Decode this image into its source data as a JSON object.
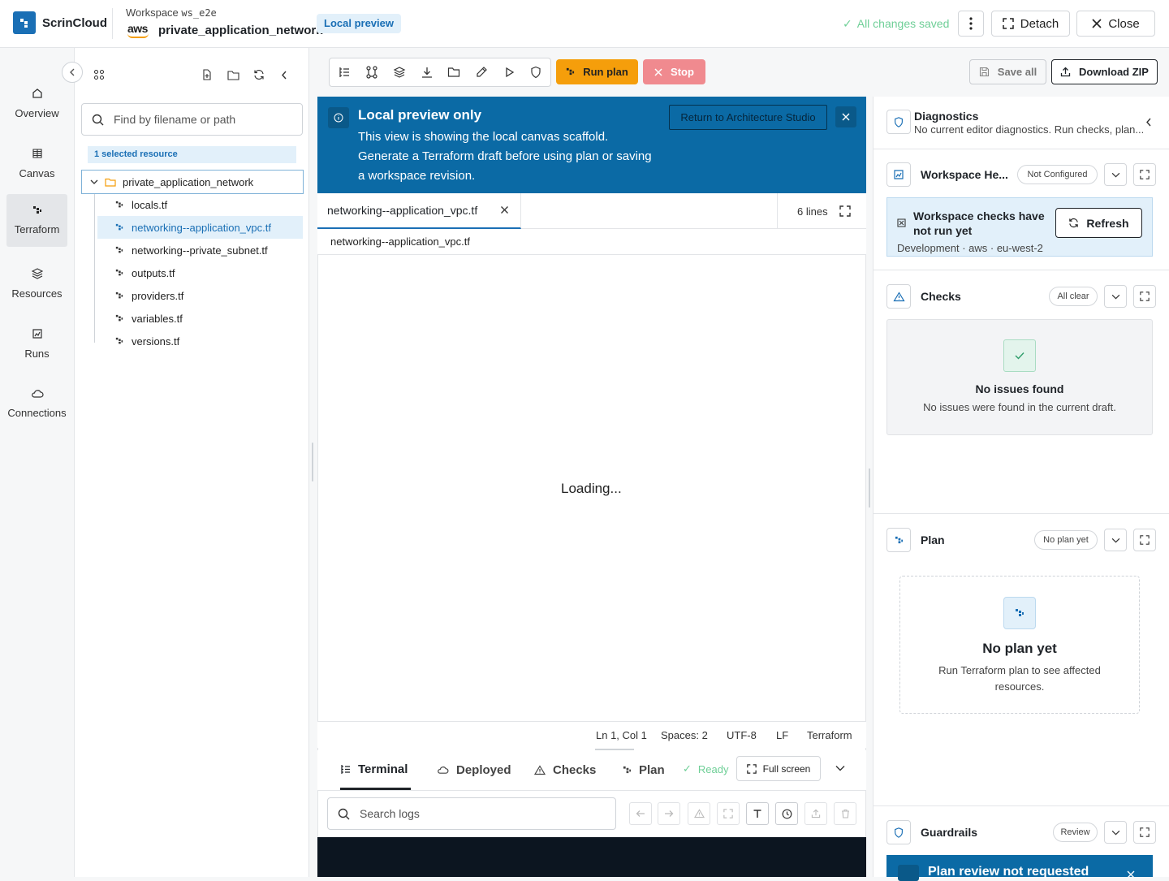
{
  "app": {
    "brand": "ScrinCloud",
    "workspace_label": "Workspace",
    "workspace_id": "ws_e2e",
    "provider_logo": "aws",
    "workspace_name": "private_application_network",
    "mode_badge": "Local preview",
    "save_status": "All changes saved",
    "detach_label": "Detach",
    "close_label": "Close"
  },
  "rail": {
    "items": [
      {
        "label": "Overview",
        "icon": "home-icon"
      },
      {
        "label": "Canvas",
        "icon": "grid-icon"
      },
      {
        "label": "Terraform",
        "icon": "terraform-icon",
        "active": true
      },
      {
        "label": "Resources",
        "icon": "layers-icon"
      },
      {
        "label": "Runs",
        "icon": "chart-icon"
      },
      {
        "label": "Connections",
        "icon": "cloud-icon"
      }
    ]
  },
  "explorer": {
    "search_placeholder": "Find by filename or path",
    "selected_resource": "1 selected resource",
    "root_folder": "private_application_network",
    "files": [
      {
        "name": "locals.tf"
      },
      {
        "name": "networking--application_vpc.tf",
        "active": true
      },
      {
        "name": "networking--private_subnet.tf"
      },
      {
        "name": "outputs.tf"
      },
      {
        "name": "providers.tf"
      },
      {
        "name": "variables.tf"
      },
      {
        "name": "versions.tf"
      }
    ]
  },
  "toolbar": {
    "run_plan": "Run plan",
    "stop": "Stop",
    "save_all": "Save all",
    "download_zip": "Download ZIP"
  },
  "banner": {
    "title": "Local preview only",
    "line1": "This view is showing the local canvas scaffold.",
    "line2": "Generate a Terraform draft before using plan or saving",
    "line3": "a workspace revision.",
    "return_button": "Return to Architecture Studio"
  },
  "editor": {
    "tab_name": "networking--application_vpc.tf",
    "lines": "6 lines",
    "breadcrumb": "networking--application_vpc.tf",
    "loading": "Loading...",
    "status": {
      "position": "Ln 1, Col 1",
      "spaces": "Spaces: 2",
      "encoding": "UTF-8",
      "eol": "LF",
      "language": "Terraform"
    }
  },
  "bottom": {
    "tabs": [
      "Terminal",
      "Deployed",
      "Checks",
      "Plan"
    ],
    "ready": "Ready",
    "full_screen": "Full screen",
    "search_placeholder": "Search logs"
  },
  "rpanel": {
    "diagnostics": {
      "title": "Diagnostics",
      "subtitle": "No current editor diagnostics. Run checks, plan..."
    },
    "workspace_health": {
      "title": "Workspace He...",
      "badge": "Not Configured",
      "card_title_1": "Workspace checks have",
      "card_title_2": "not run yet",
      "card_meta": "Development · aws · eu-west-2",
      "refresh": "Refresh"
    },
    "checks": {
      "title": "Checks",
      "badge": "All clear",
      "empty_title": "No issues found",
      "empty_body": "No issues were found in the current draft."
    },
    "plan": {
      "title": "Plan",
      "badge": "No plan yet",
      "empty_title": "No plan yet",
      "empty_body_1": "Run Terraform plan to see affected",
      "empty_body_2": "resources."
    },
    "guardrails": {
      "title": "Guardrails",
      "badge": "Review",
      "banner": "Plan review not requested"
    }
  },
  "colors": {
    "accent": "#1a6fb5",
    "banner": "#0b6aa5",
    "run": "#f59e0b",
    "stop": "#f08a8f",
    "success": "#6fcf97"
  }
}
